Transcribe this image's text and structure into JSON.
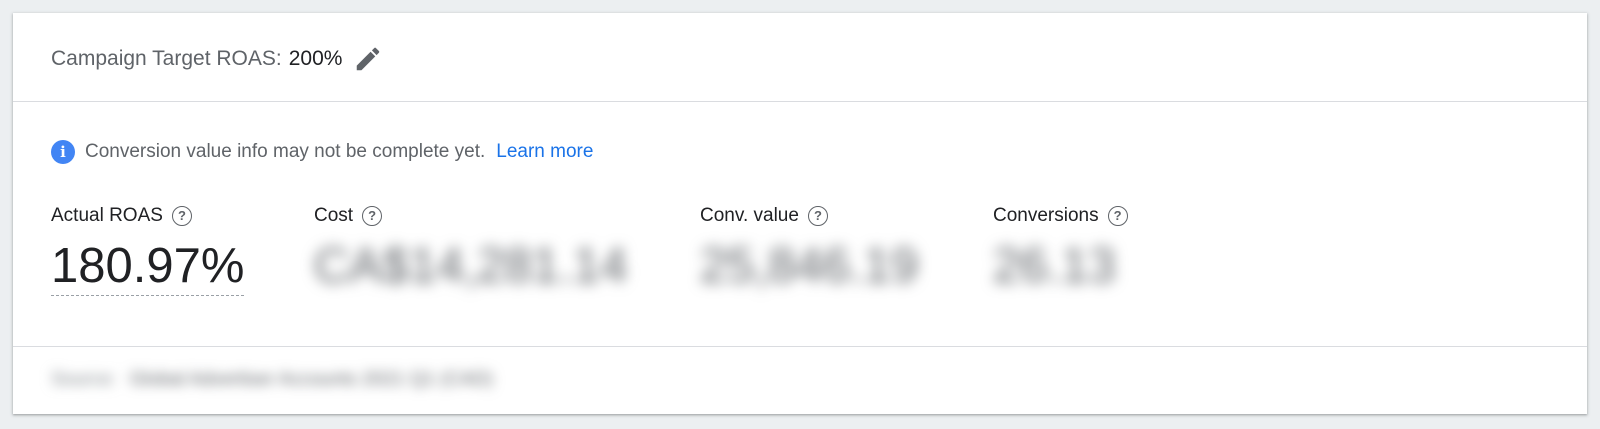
{
  "header": {
    "target_label": "Campaign Target ROAS:",
    "target_value": "200%",
    "edit_icon": "pencil-icon"
  },
  "info": {
    "icon": "info-icon",
    "message": "Conversion value info may not be complete yet.",
    "link_label": "Learn more"
  },
  "metrics": [
    {
      "label": "Actual ROAS",
      "value": "180.97%"
    },
    {
      "label": "Cost",
      "value": "CA$14,281.14"
    },
    {
      "label": "Conv. value",
      "value": "25,846.19"
    },
    {
      "label": "Conversions",
      "value": "26.13"
    }
  ],
  "footer": {
    "prefix": "Source:",
    "text": "Global Advertiser Accounts 2021 Q1 (CAD)"
  },
  "colors": {
    "accent_blue": "#1a73e8",
    "info_icon_blue": "#4285f4",
    "secondary_text": "#5f6368"
  }
}
